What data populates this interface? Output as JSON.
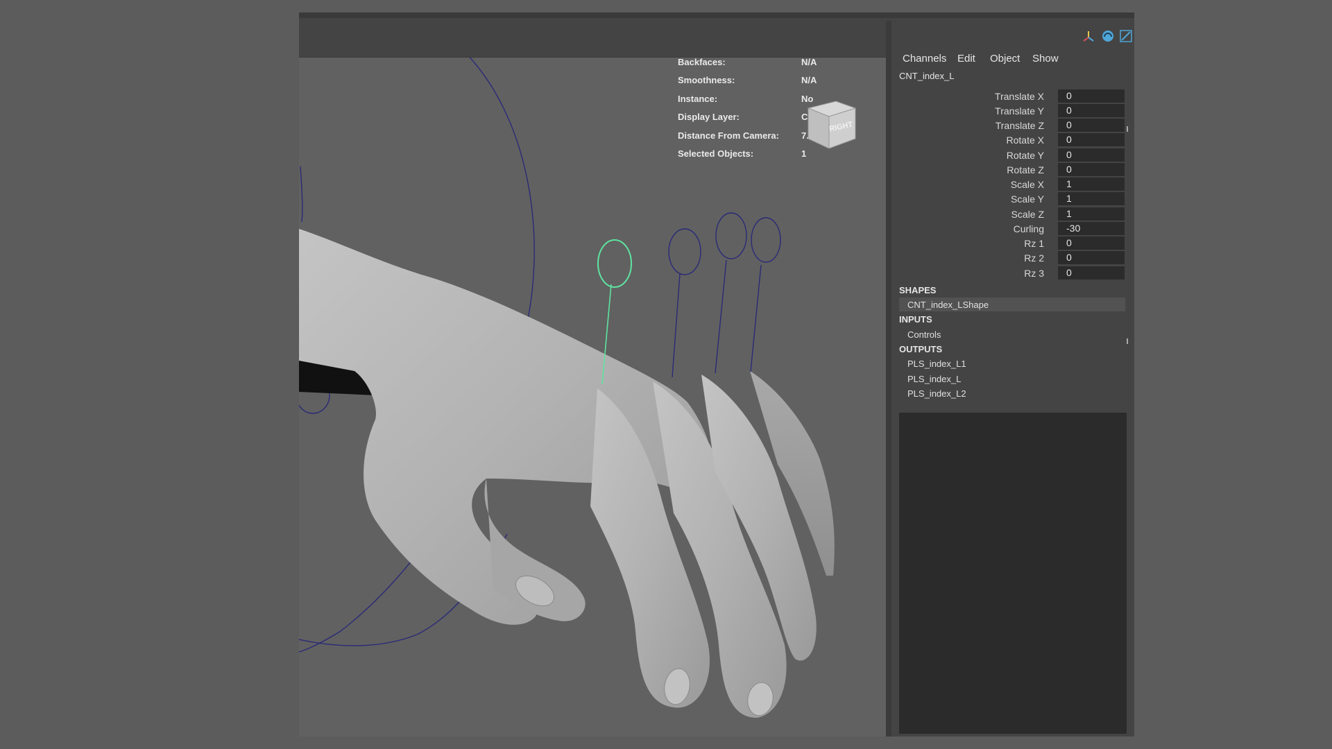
{
  "hud": {
    "rows": [
      {
        "label": "Backfaces:",
        "value": "N/A"
      },
      {
        "label": "Smoothness:",
        "value": "N/A"
      },
      {
        "label": "Instance:",
        "value": "No"
      },
      {
        "label": "Display Layer:",
        "value": "Controls"
      },
      {
        "label": "Distance From Camera:",
        "value": "7.21"
      },
      {
        "label": "Selected Objects:",
        "value": "1"
      }
    ]
  },
  "viewcube": {
    "face_label": "RIGHT"
  },
  "icons": [
    "axes-icon",
    "refresh-icon",
    "graph-editor-icon"
  ],
  "colors": {
    "selected_control": "#5fe3a1",
    "control_curve": "#2a2a78",
    "field_bg": "#2b2b2b"
  },
  "channelbox": {
    "menu": [
      "Channels",
      "Edit",
      "Object",
      "Show"
    ],
    "node": "CNT_index_L",
    "attributes": [
      {
        "label": "Translate X",
        "value": "0"
      },
      {
        "label": "Translate Y",
        "value": "0"
      },
      {
        "label": "Translate Z",
        "value": "0"
      },
      {
        "label": "Rotate X",
        "value": "0"
      },
      {
        "label": "Rotate Y",
        "value": "0"
      },
      {
        "label": "Rotate Z",
        "value": "0"
      },
      {
        "label": "Scale X",
        "value": "1"
      },
      {
        "label": "Scale Y",
        "value": "1"
      },
      {
        "label": "Scale Z",
        "value": "1"
      },
      {
        "label": "Curling",
        "value": "-30"
      },
      {
        "label": "Rz 1",
        "value": "0"
      },
      {
        "label": "Rz 2",
        "value": "0"
      },
      {
        "label": "Rz 3",
        "value": "0"
      }
    ],
    "shapes_header": "SHAPES",
    "shapes": [
      "CNT_index_LShape"
    ],
    "inputs_header": "INPUTS",
    "inputs": [
      "Controls"
    ],
    "outputs_header": "OUTPUTS",
    "outputs": [
      "PLS_index_L1",
      "PLS_index_L",
      "PLS_index_L2"
    ]
  }
}
